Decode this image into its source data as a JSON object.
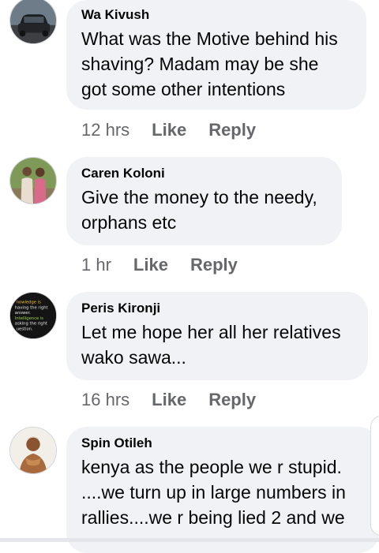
{
  "comments": [
    {
      "author": "Wa Kivush",
      "lines": [
        "What was the Motive behind his",
        "shaving? Madam may be she",
        "got some other intentions"
      ],
      "time": "12 hrs",
      "like": "Like",
      "reply": "Reply",
      "avatar": "car-photo"
    },
    {
      "author": "Caren Koloni",
      "lines": [
        "Give the money to the needy,",
        "orphans etc"
      ],
      "time": "1 hr",
      "like": "Like",
      "reply": "Reply",
      "avatar": "two-people-photo"
    },
    {
      "author": "Peris Kironji",
      "lines": [
        "Let me hope her all her relatives",
        "wako sawa..."
      ],
      "time": "16 hrs",
      "like": "Like",
      "reply": "Reply",
      "avatar": "quote-text-image",
      "avatar_text": [
        "nowledge is",
        "having the right",
        "answer.",
        "Intelligence is",
        "asking the right",
        "uestion."
      ]
    },
    {
      "author": "Spin Otileh",
      "lines": [
        "kenya as the people we r stupid.",
        "....we turn up in large numbers in",
        "rallies....we r being lied 2 and we"
      ],
      "avatar": "man-portrait-photo"
    }
  ],
  "colors": {
    "bubble": "#f0f2f5",
    "meta": "#65676b",
    "text": "#050505"
  }
}
